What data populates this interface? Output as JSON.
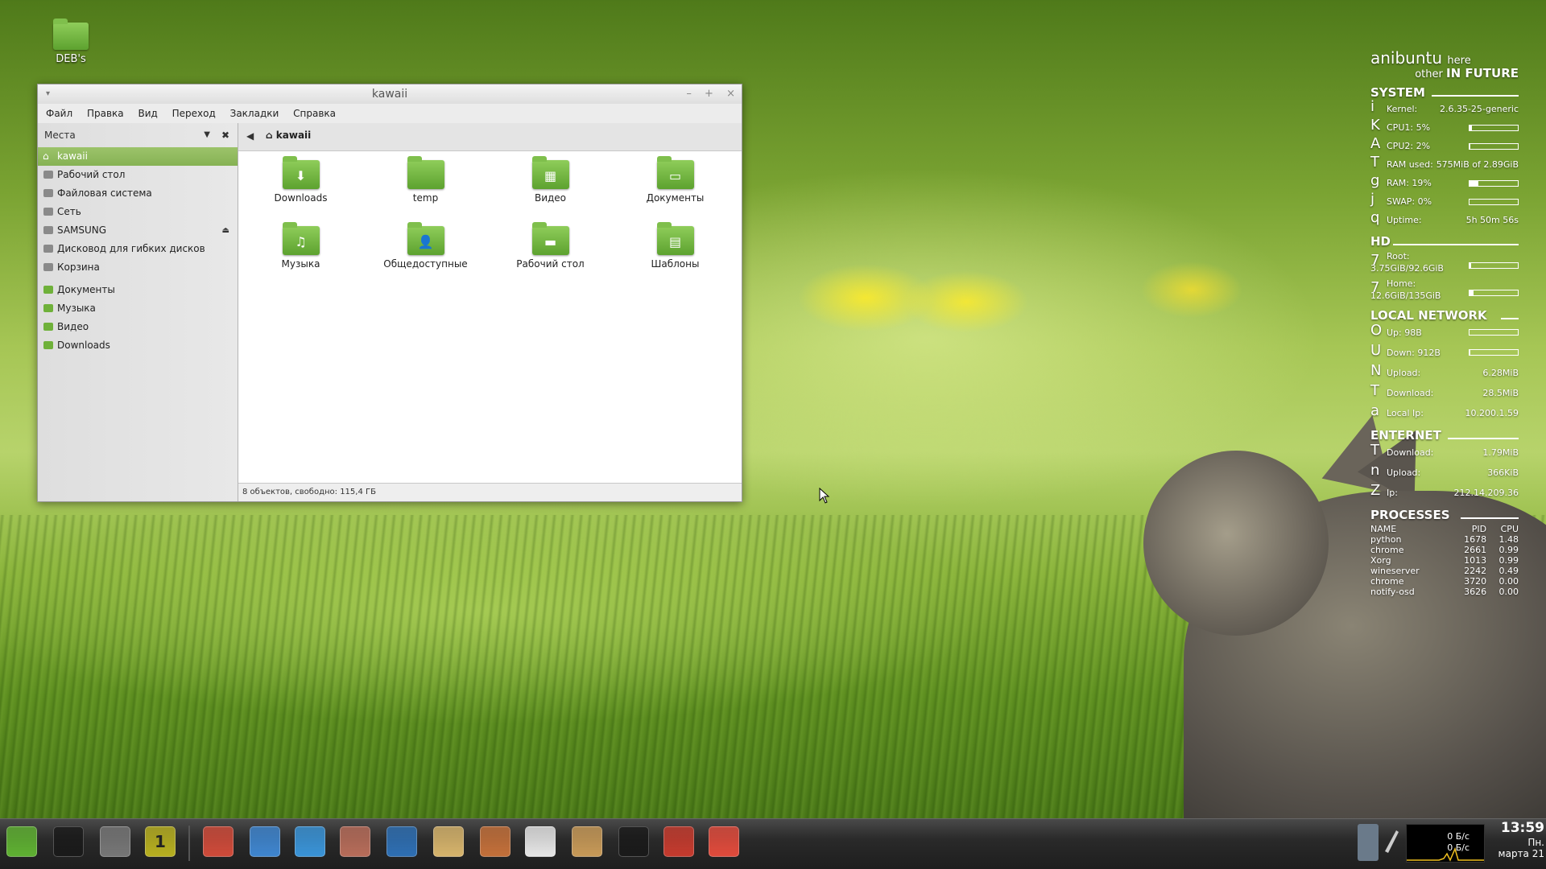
{
  "desktop": {
    "icon_label": "DEB's"
  },
  "window": {
    "title": "kawaii",
    "controls": {
      "minimize": "–",
      "maximize": "+",
      "close": "×"
    },
    "menu": [
      "Файл",
      "Правка",
      "Вид",
      "Переход",
      "Закладки",
      "Справка"
    ],
    "sidebar": {
      "header": "Места",
      "places": [
        {
          "label": "kawaii",
          "icon": "home-icon"
        },
        {
          "label": "Рабочий стол",
          "icon": "desktop-icon"
        },
        {
          "label": "Файловая система",
          "icon": "drive-icon"
        },
        {
          "label": "Сеть",
          "icon": "network-icon"
        },
        {
          "label": "SAMSUNG",
          "icon": "usb-drive-icon"
        },
        {
          "label": "Дисковод для гибких дисков",
          "icon": "floppy-icon"
        },
        {
          "label": "Корзина",
          "icon": "trash-icon"
        }
      ],
      "bookmarks": [
        {
          "label": "Документы",
          "icon": "folder-icon"
        },
        {
          "label": "Музыка",
          "icon": "folder-icon"
        },
        {
          "label": "Видео",
          "icon": "folder-icon"
        },
        {
          "label": "Downloads",
          "icon": "folder-icon"
        }
      ]
    },
    "path": "kawaii",
    "files": [
      {
        "label": "Downloads",
        "glyph": "⬇"
      },
      {
        "label": "temp",
        "glyph": ""
      },
      {
        "label": "Видео",
        "glyph": "▦"
      },
      {
        "label": "Документы",
        "glyph": "▭"
      },
      {
        "label": "Музыка",
        "glyph": "♫"
      },
      {
        "label": "Общедоступные",
        "glyph": "👤"
      },
      {
        "label": "Рабочий стол",
        "glyph": "▬"
      },
      {
        "label": "Шаблоны",
        "glyph": "▤"
      }
    ],
    "status": "8 объектов, свободно: 115,4 ГБ"
  },
  "conky": {
    "brand": "anibuntu",
    "brand_suffix": "here",
    "sub_prefix": "other",
    "sub_bold": "IN FUTURE",
    "system_title": "SYSTEM",
    "system": [
      {
        "glyph": "i",
        "key": "Kernel:",
        "value": "2.6.35-25-generic"
      },
      {
        "glyph": "K",
        "key": "CPU1: 5%",
        "bar": 0.05
      },
      {
        "glyph": "A",
        "key": "CPU2: 2%",
        "bar": 0.02
      },
      {
        "glyph": "T",
        "key": "RAM used:",
        "value": "575MiB of 2.89GiB"
      },
      {
        "glyph": "g",
        "key": "RAM: 19%",
        "bar": 0.19
      },
      {
        "glyph": "j",
        "key": "SWAP: 0%",
        "bar": 0.0
      },
      {
        "glyph": "q",
        "key": "Uptime:",
        "value": "5h 50m 56s"
      }
    ],
    "hd_title": "HD",
    "hd": [
      {
        "glyph": "7",
        "key": "Root:",
        "value": "3.75GiB/92.6GiB",
        "bar": 0.04
      },
      {
        "glyph": "7",
        "key": "Home:",
        "value": "12.6GiB/135GiB",
        "bar": 0.09
      }
    ],
    "lan_title": "LOCAL NETWORK",
    "lan": [
      {
        "glyph": "O",
        "key": "Up: 98B",
        "bar": 0.0
      },
      {
        "glyph": "U",
        "key": "Down: 912B",
        "bar": 0.02
      },
      {
        "glyph": "N",
        "key": "Upload:",
        "value": "6.28MiB"
      },
      {
        "glyph": "T",
        "key": "Download:",
        "value": "28.5MiB"
      },
      {
        "glyph": "a",
        "key": "Local Ip:",
        "value": "10.200.1.59"
      }
    ],
    "inet_title": "ENTERNET",
    "inet": [
      {
        "glyph": "T",
        "key": "Download:",
        "value": "1.79MiB"
      },
      {
        "glyph": "n",
        "key": "Upload:",
        "value": "366KiB"
      },
      {
        "glyph": "Z",
        "key": "Ip:",
        "value": "212.14.209.36"
      }
    ],
    "proc_title": "PROCESSES",
    "proc_headers": [
      "NAME",
      "PID",
      "CPU"
    ],
    "processes": [
      [
        "python",
        "1678",
        "1.48"
      ],
      [
        "chrome",
        "2661",
        "0.99"
      ],
      [
        "Xorg",
        "1013",
        "0.99"
      ],
      [
        "wineserver",
        "2242",
        "0.49"
      ],
      [
        "chrome",
        "3720",
        "0.00"
      ],
      [
        "notify-osd",
        "3626",
        "0.00"
      ]
    ]
  },
  "taskbar": {
    "launchers": [
      {
        "name": "mint-menu-icon",
        "color": "#5fb132"
      },
      {
        "name": "terminal-icon",
        "color": "#1a1a1a"
      },
      {
        "name": "speaker-icon",
        "color": "#777777"
      },
      {
        "name": "workspace-icon",
        "color": "#b8b020",
        "text": "1"
      },
      {
        "name": "pinwheel-icon",
        "color": "#d04b3a"
      },
      {
        "name": "messenger-icon",
        "color": "#3f86d0"
      },
      {
        "name": "system-monitor-icon",
        "color": "#3a94d8"
      },
      {
        "name": "debian-icon",
        "color": "#b86d5a"
      },
      {
        "name": "writer-icon",
        "color": "#2e6fb3"
      },
      {
        "name": "mail-icon",
        "color": "#d7b46c"
      },
      {
        "name": "paint-icon",
        "color": "#c4703a"
      },
      {
        "name": "text-editor-icon",
        "color": "#e6e6e6"
      },
      {
        "name": "package-icon",
        "color": "#c89a58"
      },
      {
        "name": "terminal2-icon",
        "color": "#1a1a1a"
      },
      {
        "name": "screenshot-icon",
        "color": "#c63b2e"
      },
      {
        "name": "chrome-icon",
        "color": "#e14b3c"
      }
    ],
    "net_up": "0 Б/с",
    "net_down": "0 Б/с",
    "time": "13:59",
    "day": "Пн.",
    "date": "марта 21"
  }
}
